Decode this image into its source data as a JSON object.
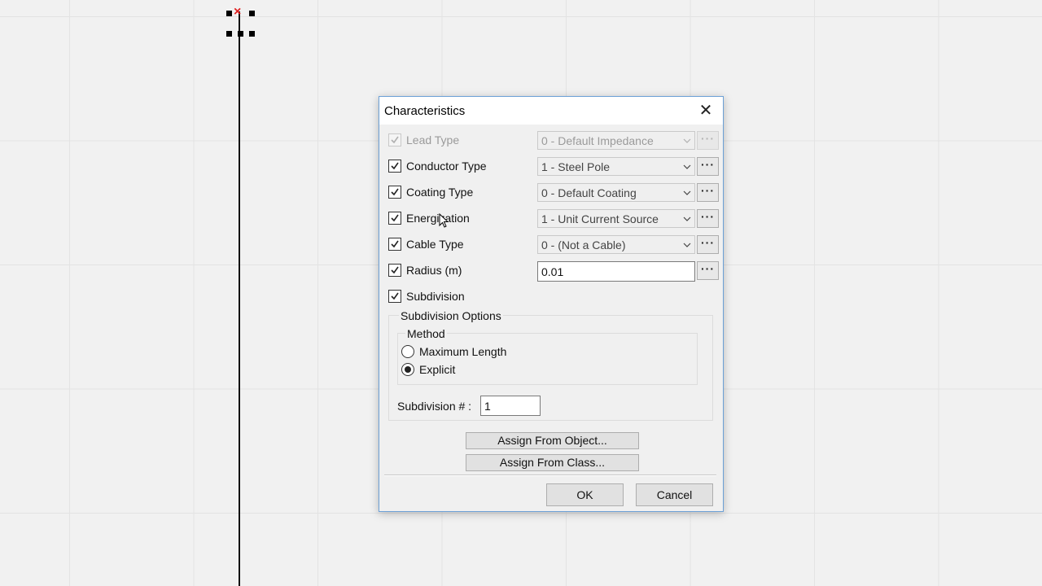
{
  "dialog": {
    "title": "Characteristics",
    "rows": [
      {
        "label": "Lead Type",
        "checked": true,
        "disabled": true,
        "value": "0 - Default Impedance"
      },
      {
        "label": "Conductor Type",
        "checked": true,
        "disabled": false,
        "value": "1 - Steel Pole"
      },
      {
        "label": "Coating Type",
        "checked": true,
        "disabled": false,
        "value": "0 - Default Coating"
      },
      {
        "label": "Energization",
        "checked": true,
        "disabled": false,
        "value": "1 - Unit Current Source"
      },
      {
        "label": "Cable Type",
        "checked": true,
        "disabled": false,
        "value": "0 - (Not a Cable)"
      },
      {
        "label": "Radius (m)",
        "checked": true,
        "disabled": false,
        "value": "0.01"
      },
      {
        "label": "Subdivision",
        "checked": true,
        "disabled": false
      }
    ],
    "dots_label": "···",
    "subdivision_options": {
      "group_title": "Subdivision Options",
      "method_title": "Method",
      "methods": [
        {
          "label": "Maximum Length",
          "selected": false
        },
        {
          "label": "Explicit",
          "selected": true
        }
      ],
      "subdivision_label": "Subdivision # :",
      "subdivision_value": "1"
    },
    "buttons": {
      "assign_object": "Assign From Object...",
      "assign_class": "Assign From Class...",
      "ok": "OK",
      "cancel": "Cancel"
    },
    "close_glyph": "✕"
  }
}
